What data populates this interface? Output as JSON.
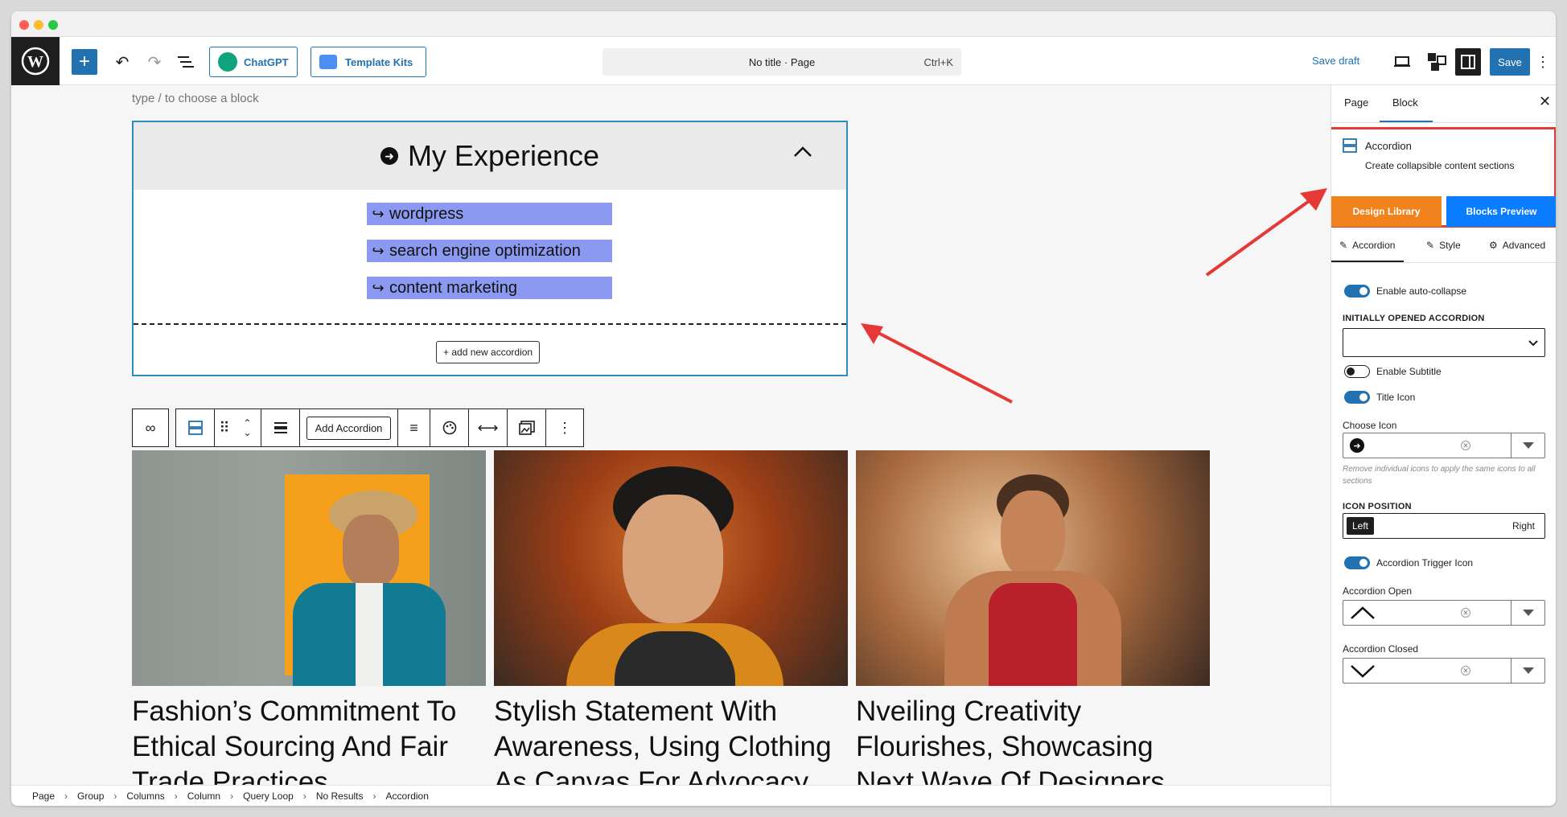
{
  "topbar": {
    "chatgpt_label": "ChatGPT",
    "template_kits_label": "Template Kits",
    "command_title": "No title · Page",
    "command_shortcut": "Ctrl+K",
    "save_draft_label": "Save draft",
    "save_label": "Save"
  },
  "canvas": {
    "placeholder": "type / to choose a block",
    "accordion": {
      "title": "My Experience",
      "items": [
        "wordpress",
        "search engine optimization",
        "content marketing"
      ],
      "add_new_label": "+ add new accordion",
      "item_color": "#8b9af0"
    },
    "block_toolbar": {
      "add_accordion_label": "Add Accordion"
    },
    "cards": [
      {
        "title": "Fashion’s Commitment To Ethical Sourcing And Fair Trade Practices"
      },
      {
        "title": "Stylish Statement With Awareness, Using Clothing As Canvas For Advocacy"
      },
      {
        "title": "Nveiling Creativity Flourishes, Showcasing Next Wave Of Designers"
      }
    ]
  },
  "breadcrumb": [
    "Page",
    "Group",
    "Columns",
    "Column",
    "Query Loop",
    "No Results",
    "Accordion"
  ],
  "sidebar": {
    "tabs": {
      "page": "Page",
      "block": "Block"
    },
    "block_card": {
      "name": "Accordion",
      "description": "Create collapsible content sections"
    },
    "design_library_label": "Design Library",
    "blocks_preview_label": "Blocks Preview",
    "sub_tabs": {
      "accordion": "Accordion",
      "style": "Style",
      "advanced": "Advanced"
    },
    "settings": {
      "enable_auto_collapse": "Enable auto-collapse",
      "initially_opened": "INITIALLY OPENED ACCORDION",
      "enable_subtitle": "Enable Subtitle",
      "title_icon": "Title Icon",
      "choose_icon": "Choose Icon",
      "remove_hint": "Remove individual icons to apply the same icons to all sections",
      "icon_position": "ICON POSITION",
      "pos_left": "Left",
      "pos_right": "Right",
      "trigger_icon": "Accordion Trigger Icon",
      "accordion_open": "Accordion Open",
      "accordion_closed": "Accordion Closed"
    }
  },
  "colors": {
    "accent": "#2271b1",
    "orange": "#f0831e",
    "blue_btn": "#0a7cff",
    "highlight": "#e53935"
  }
}
